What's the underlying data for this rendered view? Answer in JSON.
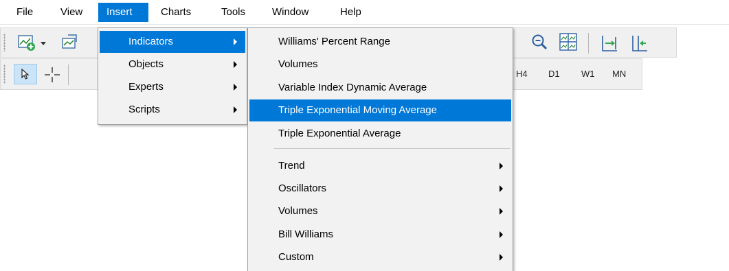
{
  "menubar": {
    "items": [
      {
        "label": "File"
      },
      {
        "label": "View"
      },
      {
        "label": "Insert"
      },
      {
        "label": "Charts"
      },
      {
        "label": "Tools"
      },
      {
        "label": "Window"
      },
      {
        "label": "Help"
      }
    ]
  },
  "insert_menu": {
    "items": [
      {
        "label": "Indicators"
      },
      {
        "label": "Objects"
      },
      {
        "label": "Experts"
      },
      {
        "label": "Scripts"
      }
    ]
  },
  "indicators_menu": {
    "items": [
      {
        "label": "Williams' Percent Range"
      },
      {
        "label": "Volumes"
      },
      {
        "label": "Variable Index Dynamic Average"
      },
      {
        "label": "Triple Exponential Moving Average"
      },
      {
        "label": "Triple Exponential Average"
      }
    ],
    "groups": [
      {
        "label": "Trend"
      },
      {
        "label": "Oscillators"
      },
      {
        "label": "Volumes"
      },
      {
        "label": "Bill Williams"
      },
      {
        "label": "Custom"
      }
    ]
  },
  "timeframes": [
    "H4",
    "D1",
    "W1",
    "MN"
  ],
  "icons": {
    "new_chart": "new-chart-icon",
    "profiles": "profiles-icon",
    "zoom": "zoom-out-icon",
    "tile": "tile-windows-icon",
    "autoscroll": "autoscroll-icon",
    "chart_shift": "chart-shift-icon",
    "cursor": "cursor-icon",
    "crosshair": "crosshair-icon"
  },
  "colors": {
    "highlight": "#0078d7",
    "menu_bg": "#f2f2f2",
    "toolbar_bg": "#f0f0f0"
  }
}
